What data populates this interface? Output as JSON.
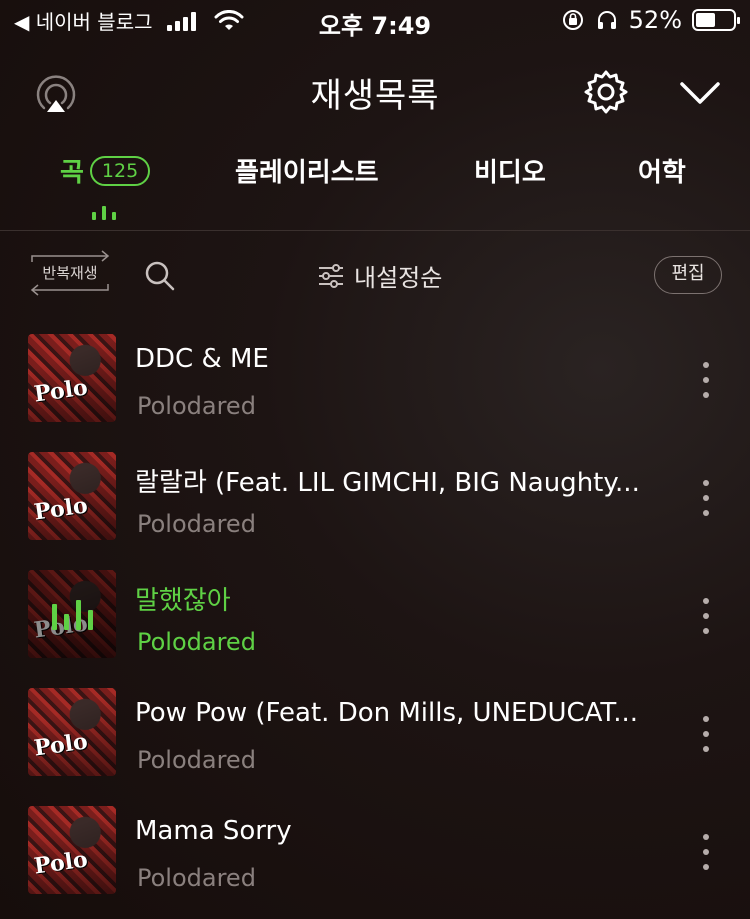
{
  "status_bar": {
    "back_app": "◀ 네이버 블로그",
    "time": "오후 7:49",
    "battery": "52%",
    "battery_level": 0.52
  },
  "header": {
    "title": "재생목록"
  },
  "tabs": [
    {
      "label": "곡",
      "count": "125",
      "active": true
    },
    {
      "label": "플레이리스트"
    },
    {
      "label": "비디오"
    },
    {
      "label": "어학"
    }
  ],
  "toolbar": {
    "repeat_label": "반복재생",
    "sort_label": "내설정순",
    "edit_label": "편집"
  },
  "songs": [
    {
      "title": "DDC & ME",
      "artist": "Polodared",
      "active": false
    },
    {
      "title": "랄랄라 (Feat. LIL GIMCHI, BIG Naughty...",
      "artist": "Polodared",
      "active": false
    },
    {
      "title": "말했잖아",
      "artist": "Polodared",
      "active": true
    },
    {
      "title": "Pow Pow (Feat. Don Mills, UNEDUCAT...",
      "artist": "Polodared",
      "active": false
    },
    {
      "title": "Mama Sorry",
      "artist": "Polodared",
      "active": false
    }
  ],
  "colors": {
    "accent": "#5fd145",
    "background": "#1a0f0d",
    "secondary_text": "#8a807e"
  },
  "icons": [
    "airplay-icon",
    "settings-icon",
    "chevron-down-icon",
    "search-icon",
    "sort-icon",
    "more-icon",
    "equalizer-icon"
  ]
}
